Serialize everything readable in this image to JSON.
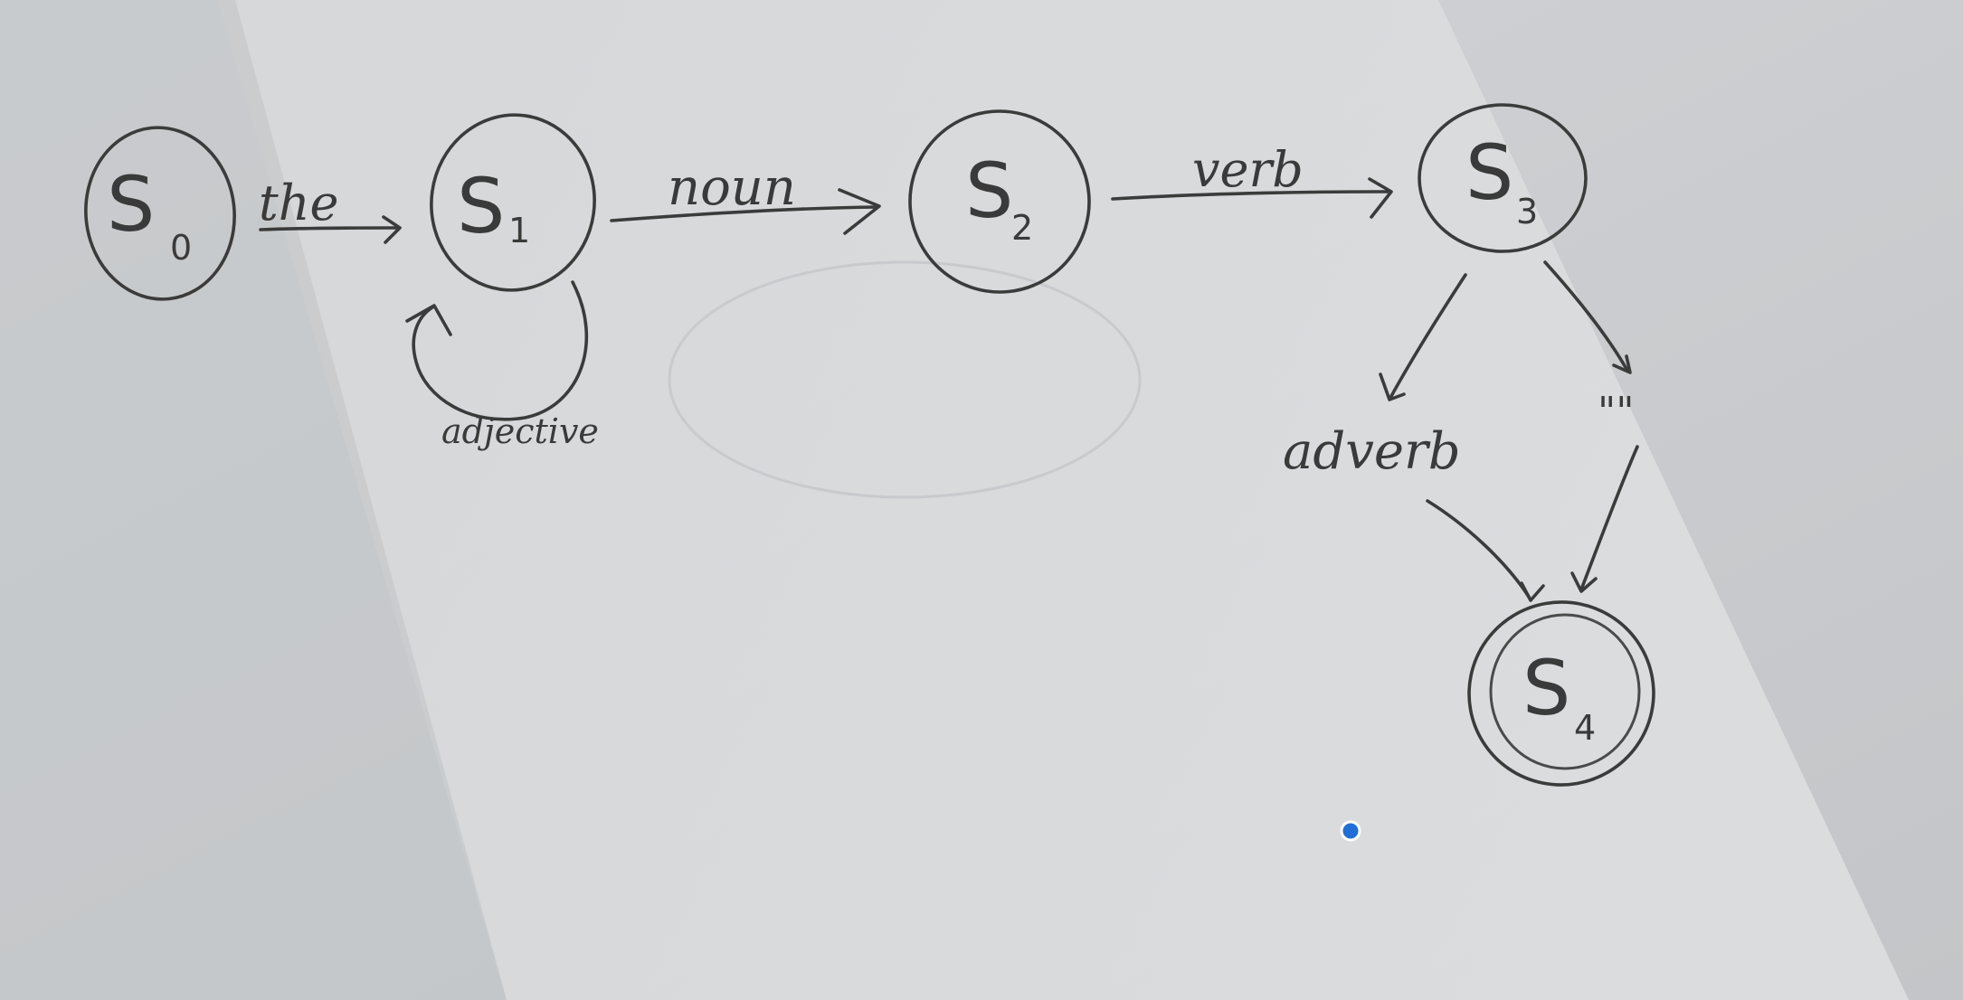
{
  "diagram": {
    "states": [
      {
        "id": "s0",
        "letter": "S",
        "sub": "0",
        "accepting": false
      },
      {
        "id": "s1",
        "letter": "S",
        "sub": "1",
        "accepting": false
      },
      {
        "id": "s2",
        "letter": "S",
        "sub": "2",
        "accepting": false
      },
      {
        "id": "s3",
        "letter": "S",
        "sub": "3",
        "accepting": false
      },
      {
        "id": "s4",
        "letter": "S",
        "sub": "4",
        "accepting": true
      }
    ],
    "transitions": [
      {
        "from": "s0",
        "to": "s1",
        "label": "the"
      },
      {
        "from": "s1",
        "to": "s1",
        "label": "adjective"
      },
      {
        "from": "s1",
        "to": "s2",
        "label": "noun"
      },
      {
        "from": "s2",
        "to": "s3",
        "label": "verb"
      },
      {
        "from": "s3",
        "to": "s4",
        "label": "adverb"
      },
      {
        "from": "s3",
        "to": "s4",
        "label": "\"\""
      }
    ]
  },
  "marker_color": "#1f6fd6",
  "ink_color": "#3b3b3b"
}
